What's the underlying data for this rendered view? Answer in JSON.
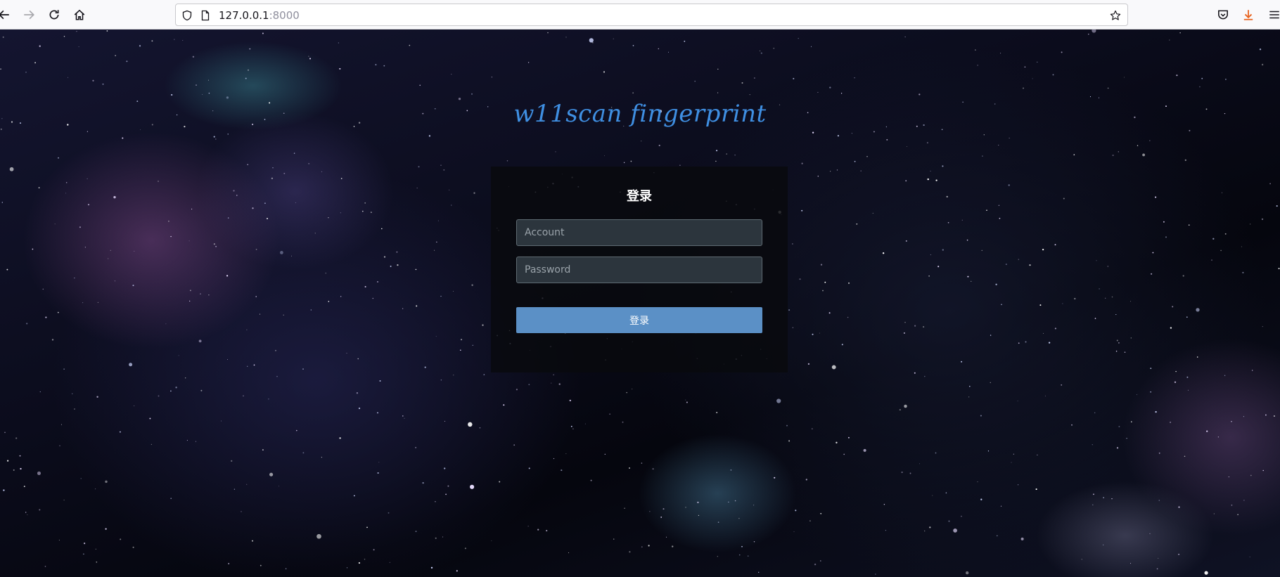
{
  "browser": {
    "url_host": "127.0.0.1",
    "url_port": ":8000",
    "icons": {
      "back": "back-arrow-icon",
      "forward": "forward-arrow-icon",
      "reload": "reload-icon",
      "home": "home-icon",
      "shield": "tracking-protection-shield-icon",
      "page": "page-info-icon",
      "bookmark": "bookmark-star-icon",
      "pocket": "pocket-icon",
      "downloads": "downloads-icon",
      "menu": "hamburger-menu-icon"
    },
    "colors": {
      "downloads_accent": "#e8631f"
    }
  },
  "page": {
    "title": "w11scan fingerprint",
    "title_color": "#3f8fe2",
    "login": {
      "heading": "登录",
      "account_placeholder": "Account",
      "password_placeholder": "Password",
      "submit_label": "登录",
      "submit_color": "#5b90c6"
    }
  }
}
